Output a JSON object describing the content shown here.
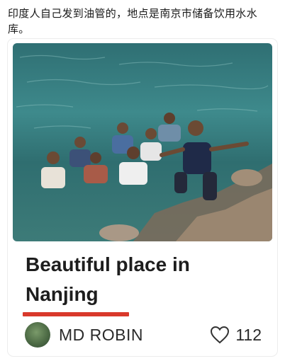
{
  "caption": "印度人自己发到油管的，地点是南京市储备饮用水水库。",
  "post": {
    "title": "Beautiful place in Nanjing",
    "author": "MD ROBIN",
    "like_count": "112"
  },
  "icons": {
    "avatar": "avatar-image",
    "like": "heart-icon"
  },
  "colors": {
    "underline": "#d9392b",
    "water": "#2f6f73",
    "text": "#1d1d1d"
  }
}
